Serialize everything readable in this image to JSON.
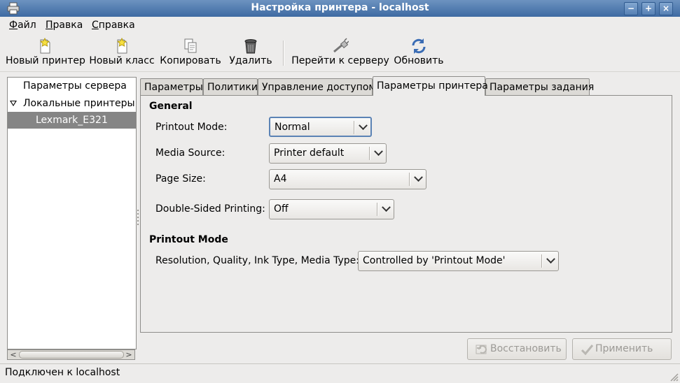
{
  "window": {
    "title": "Настройка принтера - localhost",
    "controls": [
      "−",
      "+",
      "×"
    ]
  },
  "menu": [
    "Файл",
    "Правка",
    "Справка"
  ],
  "toolbar": {
    "new_printer": "Новый принтер",
    "new_class": "Новый класс",
    "copy": "Копировать",
    "delete": "Удалить",
    "goto_server": "Перейти к серверу",
    "refresh": "Обновить"
  },
  "tree": {
    "server_settings": "Параметры сервера",
    "local_printers": "Локальные принтеры",
    "printer": "Lexmark_E321"
  },
  "tabs": [
    "Параметры",
    "Политики",
    "Управление доступом",
    "Параметры принтера",
    "Параметры задания"
  ],
  "active_tab": "Параметры принтера",
  "general": {
    "title": "General",
    "printout_mode_label": "Printout Mode:",
    "printout_mode_value": "Normal",
    "media_source_label": "Media Source:",
    "media_source_value": "Printer default",
    "page_size_label": "Page Size:",
    "page_size_value": "A4",
    "duplex_label": "Double-Sided Printing:",
    "duplex_value": "Off"
  },
  "printout_mode": {
    "title": "Printout Mode",
    "resolution_label": "Resolution, Quality, Ink Type, Media Type:",
    "resolution_value": "Controlled by 'Printout Mode'"
  },
  "buttons": {
    "revert": "Восстановить",
    "apply": "Применить"
  },
  "status": "Подключен к localhost",
  "colors": {
    "titlebar": "#3e6aa2",
    "selection": "#858585",
    "focus": "#5b83b5"
  }
}
